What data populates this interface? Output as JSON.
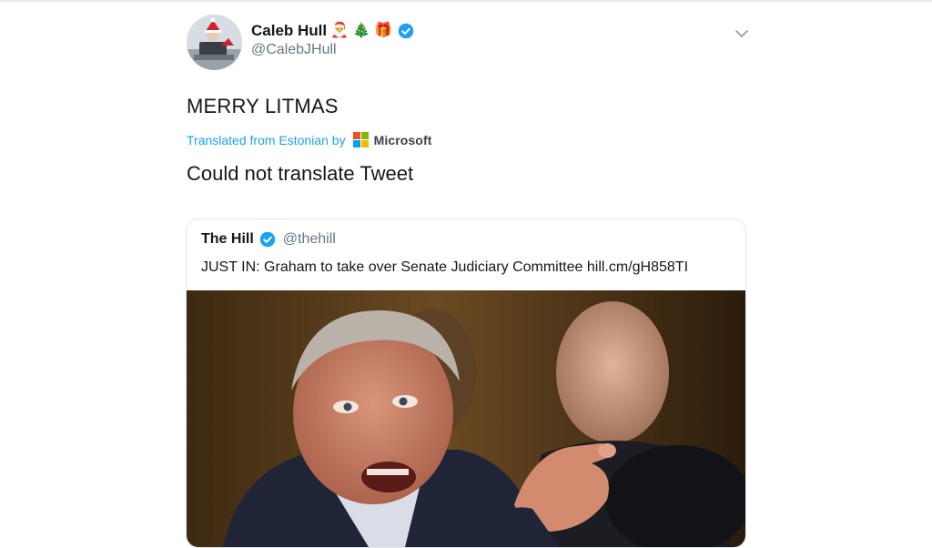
{
  "tweet": {
    "author": {
      "display_name": "Caleb Hull",
      "emojis": [
        "🎅",
        "🎄",
        "🎁"
      ],
      "handle": "@CalebJHull",
      "verified": true
    },
    "text": "MERRY LITMAS",
    "translation_label": "Translated from Estonian by",
    "translation_provider": "Microsoft",
    "translation_result": "Could not translate Tweet"
  },
  "quoted_tweet": {
    "author": {
      "display_name": "The Hill",
      "handle": "@thehill",
      "verified": true
    },
    "text": "JUST IN: Graham to take over Senate Judiciary Committee hill.cm/gH858TI"
  },
  "icons": {
    "verified": "verified-badge-icon",
    "caret": "chevron-down-icon",
    "provider_logo": "microsoft-logo-icon"
  },
  "colors": {
    "link_blue": "#1da1f2",
    "secondary_text": "#657786",
    "border": "#e1e8ed",
    "ms_red": "#f25022",
    "ms_green": "#7fba00",
    "ms_blue": "#00a4ef",
    "ms_yellow": "#ffb900"
  }
}
